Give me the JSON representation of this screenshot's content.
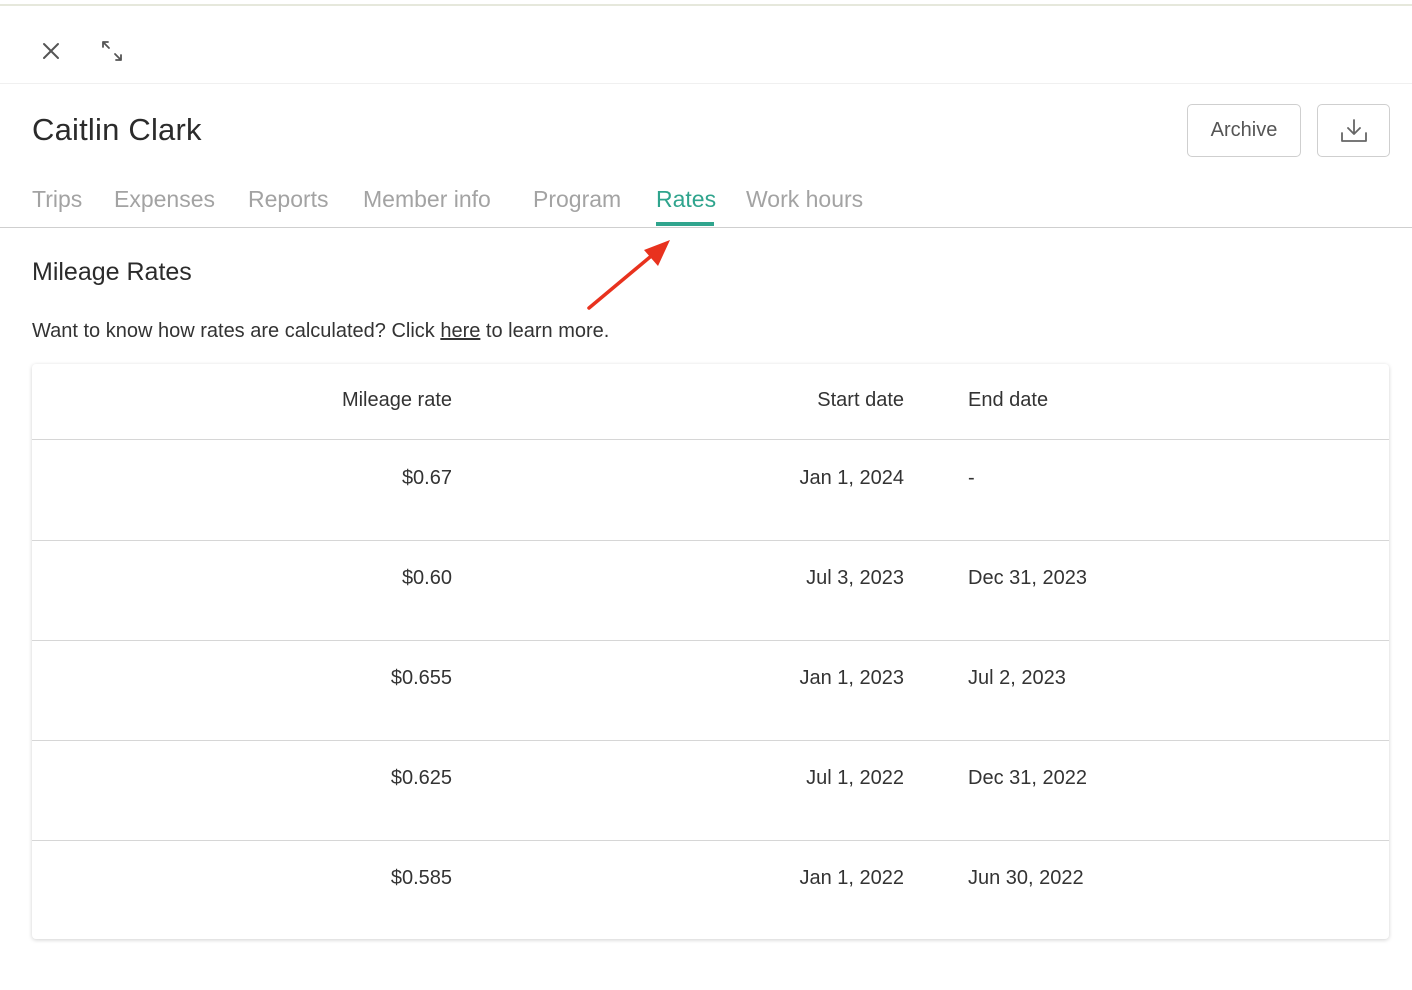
{
  "member": {
    "name": "Caitlin Clark"
  },
  "actions": {
    "archive_label": "Archive"
  },
  "tabs": [
    {
      "label": "Trips"
    },
    {
      "label": "Expenses"
    },
    {
      "label": "Reports"
    },
    {
      "label": "Member info"
    },
    {
      "label": "Program"
    },
    {
      "label": "Rates",
      "active": true
    },
    {
      "label": "Work hours"
    }
  ],
  "section": {
    "title": "Mileage Rates",
    "helper_prefix": "Want to know how rates are calculated? Click ",
    "helper_link": "here",
    "helper_suffix": " to learn more."
  },
  "table": {
    "headers": {
      "rate": "Mileage rate",
      "start": "Start date",
      "end": "End date"
    },
    "rows": [
      {
        "rate": "$0.67",
        "start": "Jan 1, 2024",
        "end": "-"
      },
      {
        "rate": "$0.60",
        "start": "Jul 3, 2023",
        "end": "Dec 31, 2023"
      },
      {
        "rate": "$0.655",
        "start": "Jan 1, 2023",
        "end": "Jul 2, 2023"
      },
      {
        "rate": "$0.625",
        "start": "Jul 1, 2022",
        "end": "Dec 31, 2022"
      },
      {
        "rate": "$0.585",
        "start": "Jan 1, 2022",
        "end": "Jun 30, 2022"
      }
    ]
  },
  "colors": {
    "accent": "#2fa48d",
    "annotation": "#e8321e"
  },
  "icons": [
    "close-icon",
    "expand-icon",
    "download-icon",
    "annotation-arrow-icon"
  ]
}
